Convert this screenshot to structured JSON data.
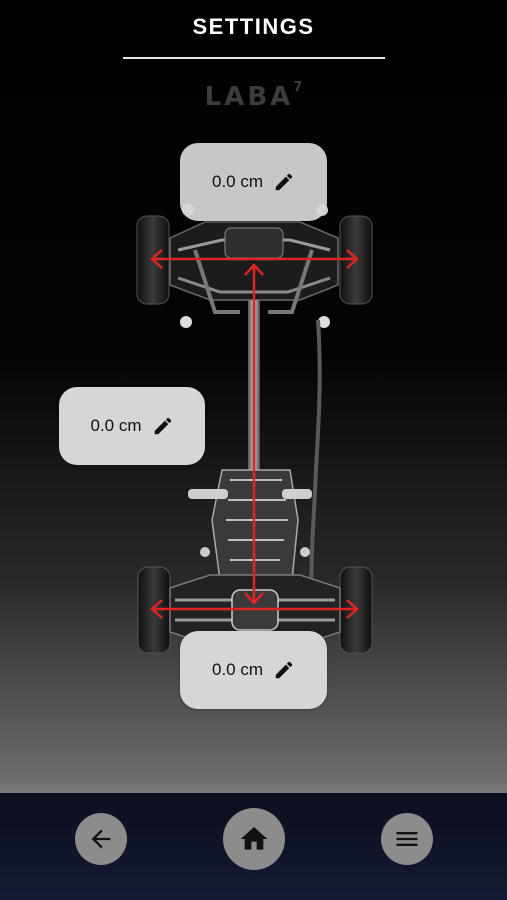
{
  "header": {
    "title": "SETTINGS"
  },
  "brand": {
    "logo_text": "LABA",
    "logo_superscript": "7"
  },
  "measurements": {
    "front_track": {
      "value": "0.0 cm",
      "icon": "pencil-edit-icon"
    },
    "wheelbase": {
      "value": "0.0 cm",
      "icon": "pencil-edit-icon"
    },
    "rear_track": {
      "value": "0.0 cm",
      "icon": "pencil-edit-icon"
    }
  },
  "navbar": {
    "back_icon": "arrow-left-icon",
    "home_icon": "home-icon",
    "menu_icon": "hamburger-menu-icon"
  },
  "colors": {
    "measure_line": "#e02424",
    "pill_bg": "#d6d6d6",
    "nav_bg": "#111528",
    "nav_button": "#8c8c8c"
  }
}
